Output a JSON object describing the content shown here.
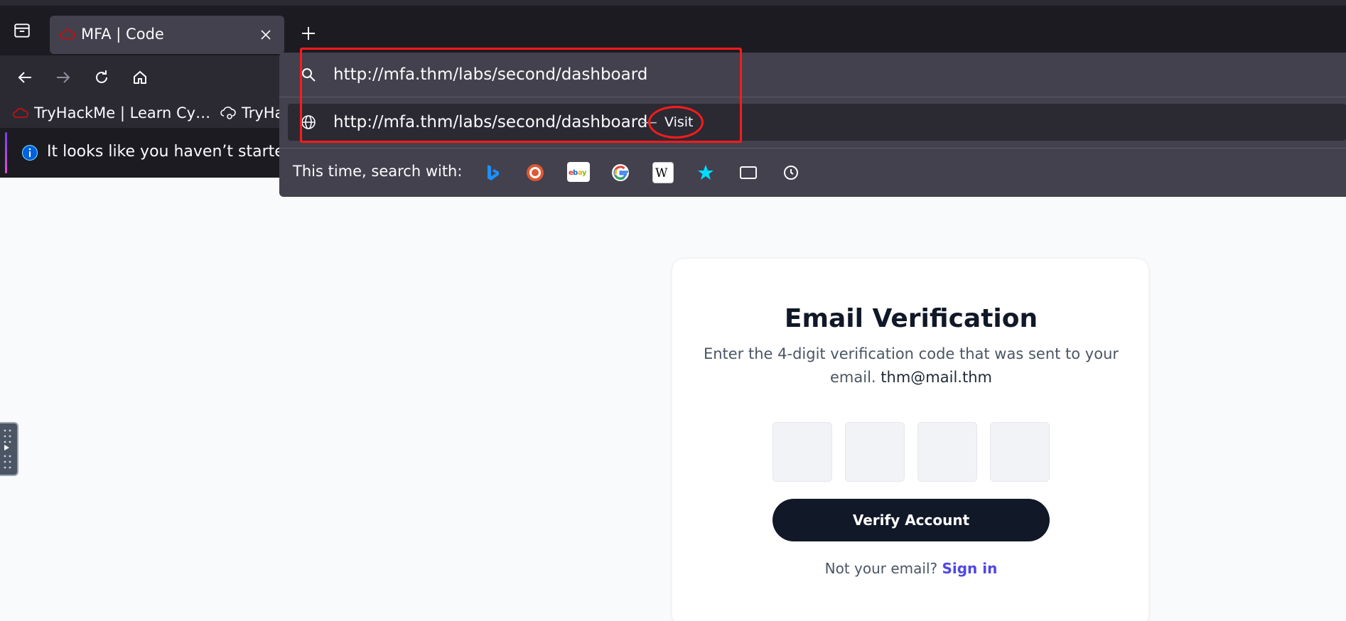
{
  "browser": {
    "tab": {
      "title": "MFA | Code"
    },
    "address_bar": {
      "value": "http://mfa.thm/labs/second/dashboard"
    },
    "suggestion": {
      "url": "http://mfa.thm/labs/second/dashboard",
      "separator": "—",
      "action": "Visit"
    },
    "search_with_label": "This time, search with:",
    "search_engines": [
      "bing-icon",
      "duckduckgo-icon",
      "ebay-icon",
      "google-icon",
      "wikipedia-icon",
      "bookmarks-icon",
      "tabs-icon",
      "history-icon"
    ],
    "bookmarks": [
      "TryHackMe | Learn Cy…",
      "TryHa"
    ],
    "notification": "It looks like you haven’t started F",
    "colors": {
      "chrome_dark": "#1c1b22",
      "chrome": "#2b2a33",
      "panel": "#42414d",
      "annotation": "#ff1a1a"
    }
  },
  "card": {
    "title": "Email Verification",
    "description": "Enter the 4-digit verification code that was sent to your email.",
    "email": "thm@mail.thm",
    "verify_button": "Verify Account",
    "signin_prompt": "Not your email?",
    "signin_link": "Sign in",
    "colors": {
      "button": "#111827",
      "link": "#4f46e5"
    }
  }
}
